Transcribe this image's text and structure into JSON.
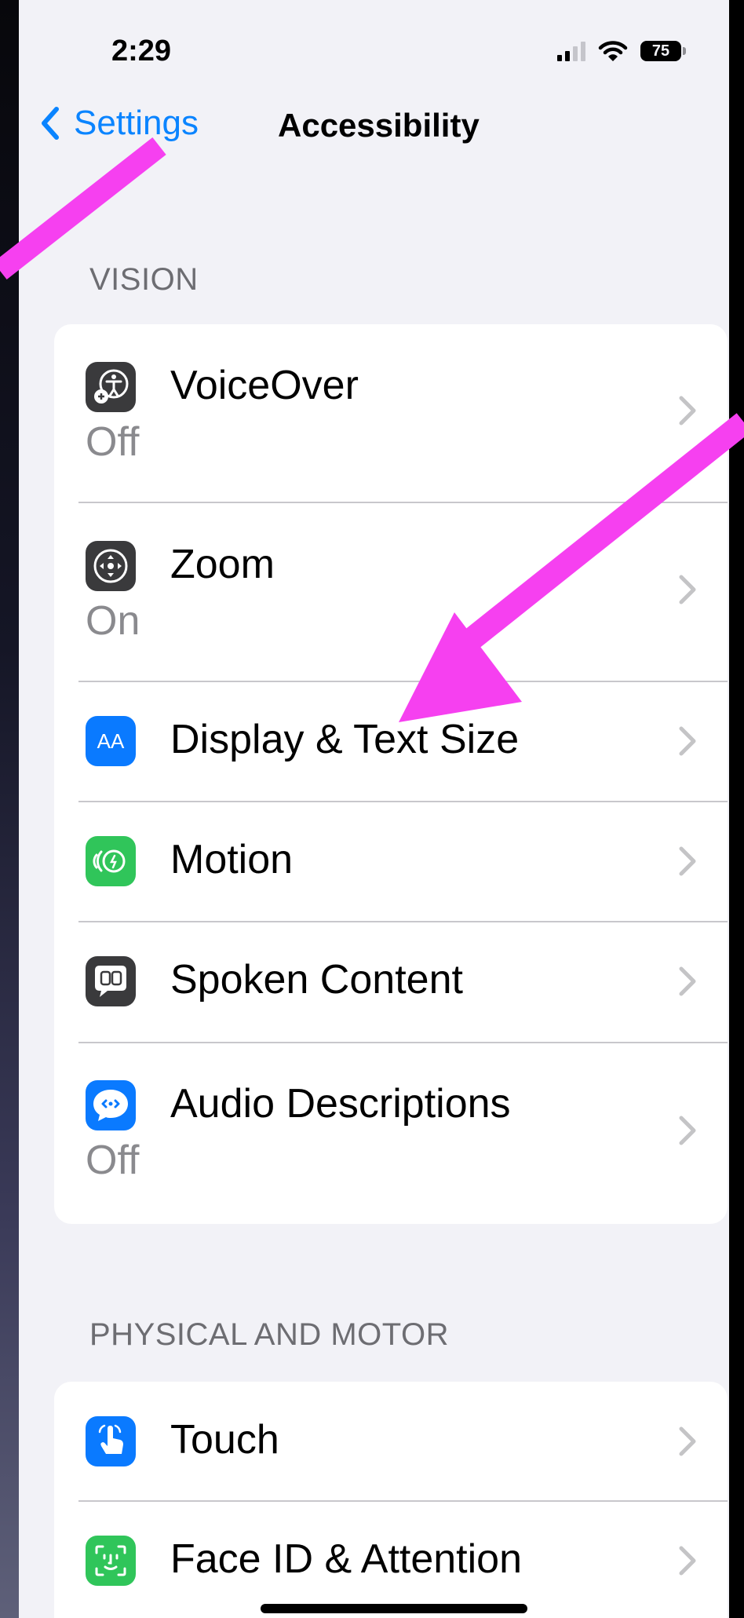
{
  "status_bar": {
    "time": "2:29",
    "battery": "75"
  },
  "nav": {
    "back_label": "Settings",
    "title": "Accessibility"
  },
  "sections": [
    {
      "header": "VISION",
      "items": [
        {
          "label": "VoiceOver",
          "value": "Off",
          "icon": "voiceover-icon"
        },
        {
          "label": "Zoom",
          "value": "On",
          "icon": "zoom-icon"
        },
        {
          "label": "Display & Text Size",
          "icon": "text-size-icon",
          "icon_text": "AA"
        },
        {
          "label": "Motion",
          "icon": "motion-icon"
        },
        {
          "label": "Spoken Content",
          "icon": "spoken-content-icon"
        },
        {
          "label": "Audio Descriptions",
          "value": "Off",
          "icon": "audio-descriptions-icon"
        }
      ]
    },
    {
      "header": "PHYSICAL AND MOTOR",
      "items": [
        {
          "label": "Touch",
          "icon": "touch-icon"
        },
        {
          "label": "Face ID & Attention",
          "icon": "face-id-icon"
        }
      ]
    }
  ],
  "colors": {
    "accent_blue": "#0a84ff",
    "icon_gray": "#3a3a3c",
    "icon_blue": "#0a7aff",
    "icon_green": "#30c55a",
    "annotation_arrow": "#f640f0"
  }
}
